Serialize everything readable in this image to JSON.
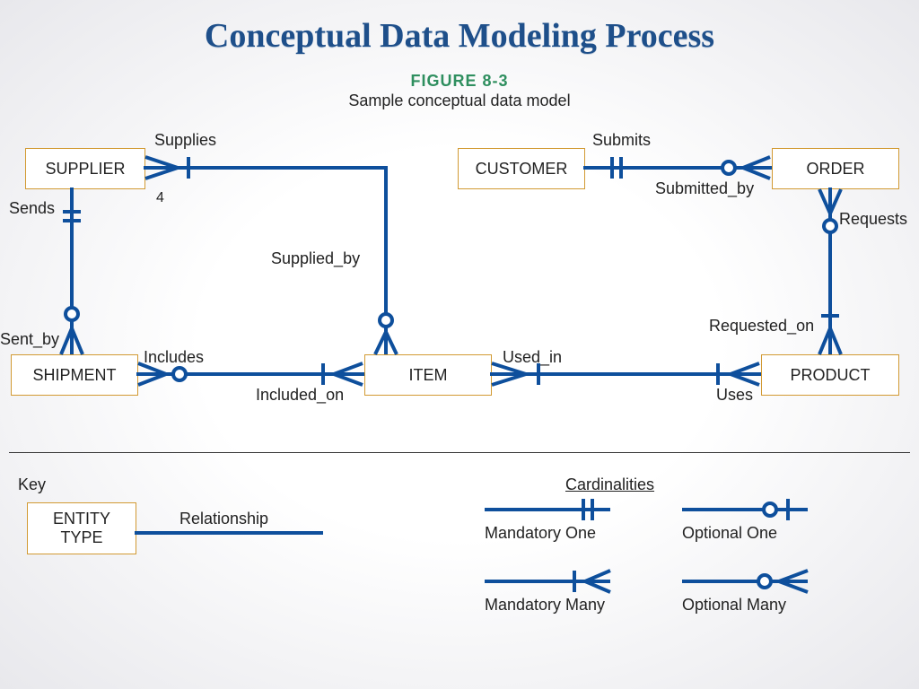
{
  "title": "Conceptual Data Modeling Process",
  "figure_label": "FIGURE 8-3",
  "figure_caption": "Sample conceptual data model",
  "entities": {
    "supplier": "SUPPLIER",
    "customer": "CUSTOMER",
    "order": "ORDER",
    "shipment": "SHIPMENT",
    "item": "ITEM",
    "product": "PRODUCT",
    "key_entity": "ENTITY\nTYPE"
  },
  "relationships": {
    "supplies": "Supplies",
    "supplied_by": "Supplied_by",
    "sends": "Sends",
    "sent_by": "Sent_by",
    "includes": "Includes",
    "included_on": "Included_on",
    "submits": "Submits",
    "submitted_by": "Submitted_by",
    "requests": "Requests",
    "requested_on": "Requested_on",
    "used_in": "Used_in",
    "uses": "Uses",
    "key_rel": "Relationship"
  },
  "note_number": "4",
  "key": {
    "heading": "Key",
    "cardinalities_heading": "Cardinalities",
    "mandatory_one": "Mandatory One",
    "optional_one": "Optional One",
    "mandatory_many": "Mandatory Many",
    "optional_many": "Optional Many"
  },
  "colors": {
    "line": "#0e4f9c",
    "entity_border": "#d29a33",
    "title": "#1e4f8a",
    "figure": "#2f8f5f"
  }
}
